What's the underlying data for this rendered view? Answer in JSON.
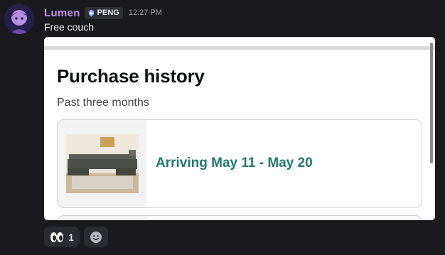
{
  "message": {
    "username": "Lumen",
    "tag": "PENG",
    "timestamp": "12:27 PM",
    "text": "Free couch"
  },
  "embed": {
    "title": "Purchase history",
    "subtitle": "Past three months",
    "order_status": "Arriving May 11 - May 20"
  },
  "reactions": [
    {
      "emoji": "eyes-icon",
      "count": "1"
    },
    {
      "emoji": "add-reaction-icon"
    }
  ],
  "colors": {
    "background": "#1a1a1e",
    "username": "#c48cf0",
    "status": "#227a6b"
  }
}
